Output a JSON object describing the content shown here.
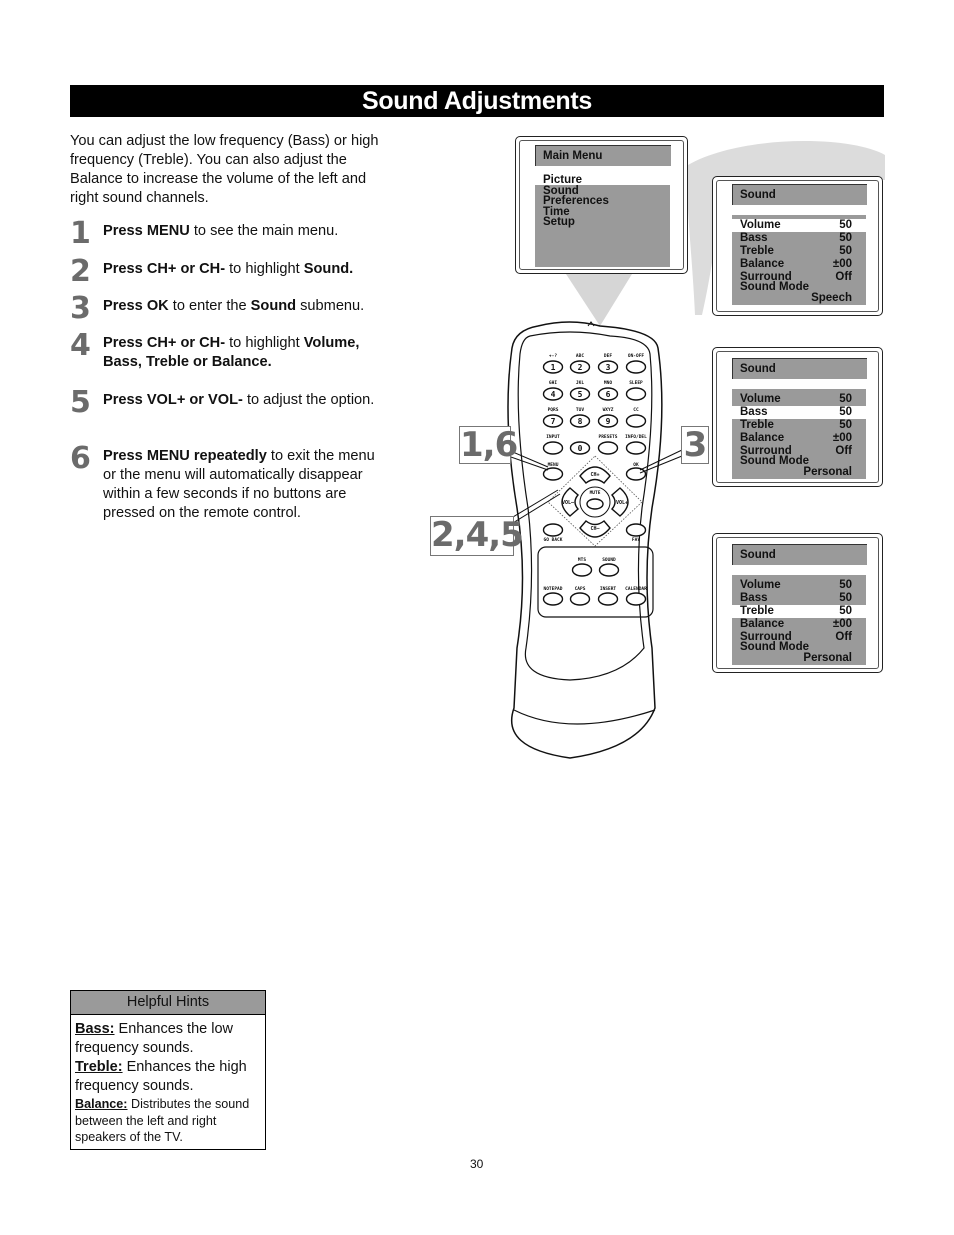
{
  "page": {
    "title": "Sound Adjustments",
    "intro": "You can adjust the low frequency (Bass) or high frequency (Treble). You can also adjust the Balance to increase the volume of the left and right sound channels.",
    "page_number": "30"
  },
  "steps": [
    {
      "num": "1",
      "parts": [
        {
          "b": "Press MENU"
        },
        {
          "t": " to see the main menu."
        }
      ]
    },
    {
      "num": "2",
      "parts": [
        {
          "b": "Press CH+ or CH-"
        },
        {
          "t": " to highlight "
        },
        {
          "b": "Sound."
        }
      ]
    },
    {
      "num": "3",
      "parts": [
        {
          "b": "Press OK"
        },
        {
          "t": " to enter the "
        },
        {
          "b": "Sound"
        },
        {
          "t": " submenu."
        }
      ]
    },
    {
      "num": "4",
      "parts": [
        {
          "b": "Press CH+ or CH-"
        },
        {
          "t": " to highlight "
        },
        {
          "b": "Volume, Bass, Treble or Balance."
        }
      ]
    },
    {
      "num": "5",
      "parts": [
        {
          "b": "Press VOL+ or VOL-"
        },
        {
          "t": " to adjust the option."
        }
      ]
    },
    {
      "num": "6",
      "parts": [
        {
          "b": "Press MENU repeatedly"
        },
        {
          "t": " to exit the menu or the menu will automatically disappear within a few seconds if no buttons are pressed on the remote control."
        }
      ]
    }
  ],
  "hints": {
    "title": "Helpful Hints",
    "items": [
      {
        "term": "Bass:",
        "desc": " Enhances the low frequency sounds."
      },
      {
        "term": "Treble:",
        "desc": " Enhances the high frequency sounds."
      },
      {
        "term": "Balance:",
        "desc": " Distributes the sound between the left and right speakers of the TV."
      }
    ]
  },
  "main_menu": {
    "title": "Main Menu",
    "items": [
      "Picture",
      "Sound",
      "Preferences",
      "Time",
      "Setup"
    ],
    "highlighted": "Picture"
  },
  "sound_menus": [
    {
      "title": "Sound",
      "highlighted": "Volume",
      "rows": [
        {
          "label": "Volume",
          "value": "50"
        },
        {
          "label": "Bass",
          "value": "50"
        },
        {
          "label": "Treble",
          "value": "50"
        },
        {
          "label": "Balance",
          "value": "±00"
        },
        {
          "label": "Surround",
          "value": "Off"
        }
      ],
      "mode_label": "Sound Mode",
      "mode_value": "Speech"
    },
    {
      "title": "Sound",
      "highlighted": "Bass",
      "rows": [
        {
          "label": "Volume",
          "value": "50"
        },
        {
          "label": "Bass",
          "value": "50"
        },
        {
          "label": "Treble",
          "value": "50"
        },
        {
          "label": "Balance",
          "value": "±00"
        },
        {
          "label": "Surround",
          "value": "Off"
        }
      ],
      "mode_label": "Sound Mode",
      "mode_value": "Personal"
    },
    {
      "title": "Sound",
      "highlighted": "Treble",
      "rows": [
        {
          "label": "Volume",
          "value": "50"
        },
        {
          "label": "Bass",
          "value": "50"
        },
        {
          "label": "Treble",
          "value": "50"
        },
        {
          "label": "Balance",
          "value": "±00"
        },
        {
          "label": "Surround",
          "value": "Off"
        }
      ],
      "mode_label": "Sound Mode",
      "mode_value": "Personal"
    }
  ],
  "remote": {
    "callouts": [
      "1,6",
      "3",
      "2,4,5"
    ],
    "numpad": [
      {
        "top": "+-?",
        "label": "1"
      },
      {
        "top": "ABC",
        "label": "2"
      },
      {
        "top": "DEF",
        "label": "3"
      },
      {
        "top": "ON-OFF",
        "label": ""
      },
      {
        "top": "GHI",
        "label": "4"
      },
      {
        "top": "JKL",
        "label": "5"
      },
      {
        "top": "MNO",
        "label": "6"
      },
      {
        "top": "SLEEP",
        "label": ""
      },
      {
        "top": "PQRS",
        "label": "7"
      },
      {
        "top": "TUV",
        "label": "8"
      },
      {
        "top": "WXYZ",
        "label": "9"
      },
      {
        "top": "CC",
        "label": ""
      },
      {
        "top": "INPUT",
        "label": ""
      },
      {
        "top": "",
        "label": "0"
      },
      {
        "top": "PRESETS",
        "label": ""
      },
      {
        "top": "INFO/DEL",
        "label": ""
      }
    ],
    "menu_label": "MENU",
    "ok_label": "OK",
    "ch_up": "CH+",
    "ch_down": "CH–",
    "vol_down": "VOL–",
    "vol_up": "VOL+",
    "mute": "MUTE",
    "go_back": "GO BACK",
    "fav": "FAV",
    "bottom_row1": [
      "MTS",
      "SOUND"
    ],
    "bottom_row2": [
      "NOTEPAD",
      "CAPS",
      "INSERT",
      "CALENDAR"
    ]
  }
}
